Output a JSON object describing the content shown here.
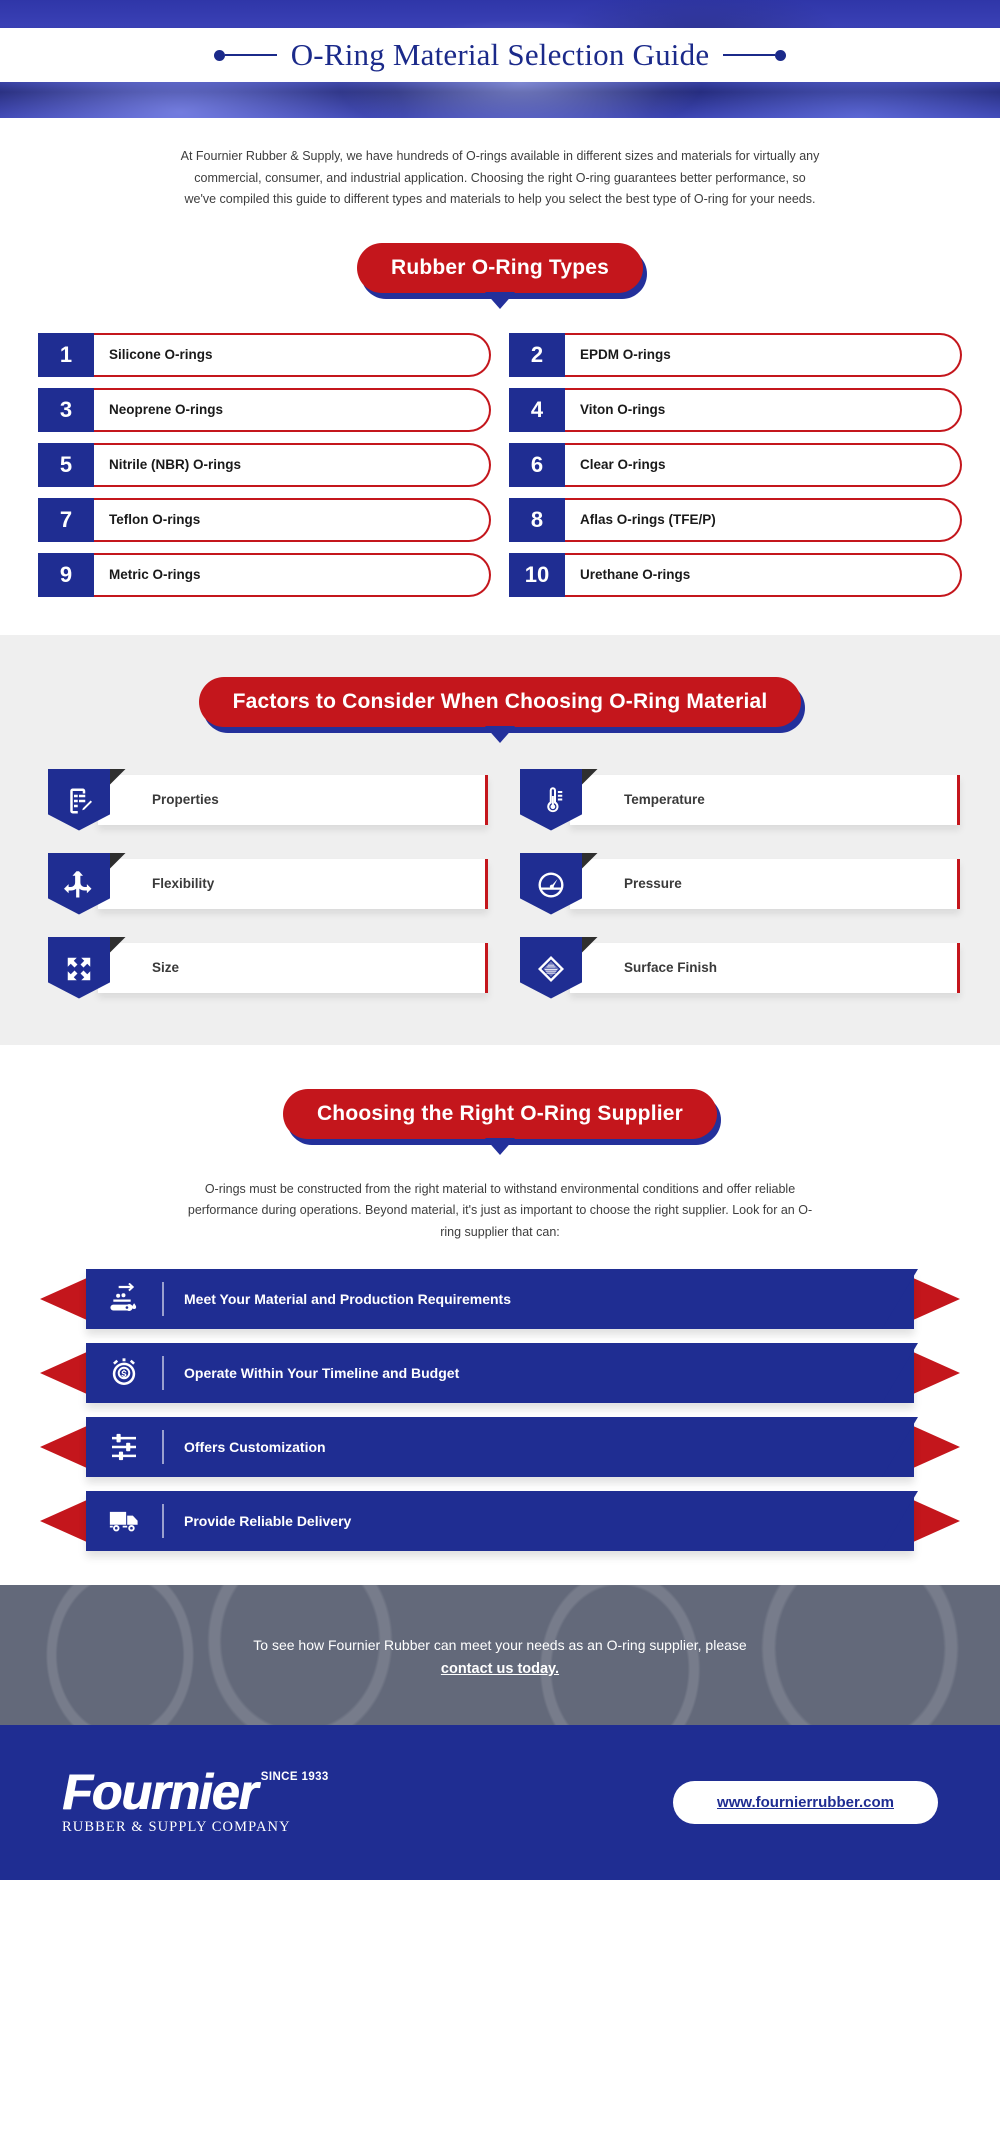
{
  "header": {
    "title": "O-Ring Material Selection Guide",
    "left_marker": "dot-dash",
    "right_marker": "dash-dot"
  },
  "intro": {
    "paragraph": "At Fournier Rubber & Supply, we have hundreds of O-rings available in different sizes and materials for virtually any commercial, consumer, and industrial application. Choosing the right O-ring guarantees better performance, so we've compiled this guide to different types and materials to help you select the best type of O-ring for your needs."
  },
  "types_section": {
    "heading": "Rubber O-Ring Types",
    "items": [
      {
        "number": "1",
        "label": "Silicone O-rings"
      },
      {
        "number": "2",
        "label": "EPDM O-rings"
      },
      {
        "number": "3",
        "label": "Neoprene O-rings"
      },
      {
        "number": "4",
        "label": "Viton O-rings"
      },
      {
        "number": "5",
        "label": "Nitrile (NBR) O-rings"
      },
      {
        "number": "6",
        "label": "Clear O-rings"
      },
      {
        "number": "7",
        "label": "Teflon O-rings"
      },
      {
        "number": "8",
        "label": "Aflas O-rings (TFE/P)"
      },
      {
        "number": "9",
        "label": "Metric O-rings"
      },
      {
        "number": "10",
        "label": "Urethane O-rings"
      }
    ]
  },
  "factors_section": {
    "heading": "Factors to Consider When Choosing O-Ring Material",
    "items": [
      {
        "label": "Properties",
        "icon": "clipboard-pencil-icon"
      },
      {
        "label": "Temperature",
        "icon": "thermometer-icon"
      },
      {
        "label": "Flexibility",
        "icon": "branching-arrows-icon"
      },
      {
        "label": "Pressure",
        "icon": "gauge-icon"
      },
      {
        "label": "Size",
        "icon": "expand-arrows-icon"
      },
      {
        "label": "Surface Finish",
        "icon": "diamond-texture-icon"
      }
    ]
  },
  "supplier_section": {
    "heading": "Choosing the Right O-Ring Supplier",
    "paragraph": "O-rings must be constructed from the right material to withstand environmental conditions and offer reliable performance during operations. Beyond material, it's just as important to choose the right supplier. Look for an O-ring supplier that can:",
    "items": [
      {
        "label": "Meet Your Material and Production Requirements",
        "icon": "production-flow-icon"
      },
      {
        "label": "Operate Within Your Timeline and Budget",
        "icon": "alarm-dollar-icon"
      },
      {
        "label": "Offers Customization",
        "icon": "sliders-icon"
      },
      {
        "label": "Provide Reliable Delivery",
        "icon": "delivery-truck-icon"
      }
    ]
  },
  "cta": {
    "text": "To see how Fournier Rubber can meet your needs as an O-ring supplier, please",
    "link": "contact us today."
  },
  "footer": {
    "logo_word": "Fournier",
    "logo_since": "SINCE 1933",
    "logo_sub": "RUBBER & SUPPLY COMPANY",
    "url": "www.fournierrubber.com"
  },
  "colors": {
    "brand_blue": "#1f2d92",
    "brand_red": "#c4161c",
    "gray_section": "#efefef",
    "cta_gray": "#63697a"
  }
}
